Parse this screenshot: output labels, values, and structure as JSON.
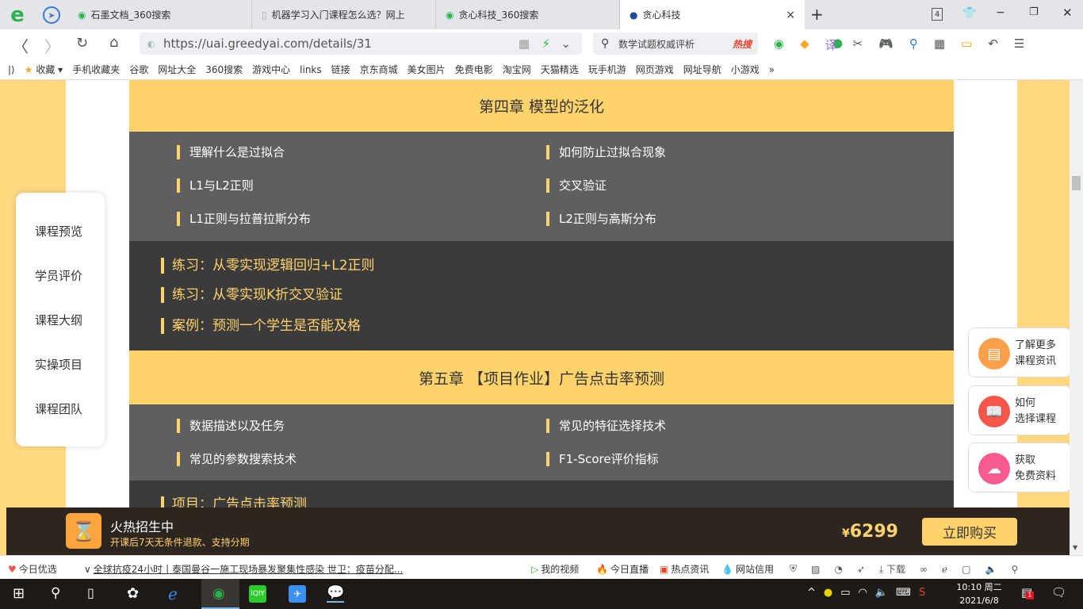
{
  "browser": {
    "tabs": [
      {
        "label": "石墨文档_360搜索",
        "active": false
      },
      {
        "label": "机器学习入门课程怎么选？网上",
        "active": false
      },
      {
        "label": "贪心科技_360搜索",
        "active": false
      },
      {
        "label": "贪心科技",
        "active": true
      }
    ],
    "tab_count": "4",
    "url": "https://uai.greedyai.com/details/31",
    "search_placeholder": "数学试题权威评析",
    "hot_search": "热搜",
    "bookmarks": [
      "收藏",
      "手机收藏夹",
      "谷歌",
      "网址大全",
      "360搜索",
      "游戏中心",
      "links",
      "链接",
      "京东商城",
      "美女图片",
      "免费电影",
      "淘宝网",
      "天猫精选",
      "玩手机游",
      "网页游戏",
      "网址导航",
      "小游戏",
      "»"
    ]
  },
  "side_nav": [
    "课程预览",
    "学员评价",
    "课程大纲",
    "实操项目",
    "课程团队"
  ],
  "chapters": [
    {
      "title": "第四章 模型的泛化",
      "topics": [
        "理解什么是过拟合",
        "如何防止过拟合现象",
        "L1与L2正则",
        "交叉验证",
        "L1正则与拉普拉斯分布",
        "L2正则与高斯分布"
      ],
      "exercises": [
        "练习：从零实现逻辑回归+L2正则",
        "练习：从零实现K折交叉验证",
        "案例：预测一个学生是否能及格"
      ]
    },
    {
      "title": "第五章 【项目作业】广告点击率预测",
      "topics": [
        "数据描述以及任务",
        "常见的特征选择技术",
        "常见的参数搜索技术",
        "F1-Score评价指标"
      ],
      "exercises": [
        "项目：广告点击率预测"
      ]
    }
  ],
  "right_cards": [
    {
      "line1": "了解更多",
      "line2": "课程资讯",
      "color": "#fba04a"
    },
    {
      "line1": "如何",
      "line2": "选择课程",
      "color": "#f5564a"
    },
    {
      "line1": "获取",
      "line2": "免费资料",
      "color": "#f85a92"
    }
  ],
  "bottom_bar": {
    "title": "火热招生中",
    "subtitle": "开课后7天无条件退款、支持分期",
    "currency": "¥",
    "price": "6299",
    "buy_label": "立即购买"
  },
  "status_bar": {
    "today": "今日优选",
    "news": "全球抗疫24小时丨泰国曼谷一施工现场暴发聚集性感染 世卫：疫苗分配...",
    "links": [
      "我的视频",
      "今日直播",
      "热点资讯",
      "网站信用"
    ],
    "download": "下载"
  },
  "taskbar": {
    "time": "10:10 周二",
    "date": "2021/6/8",
    "notif": "1"
  },
  "colors": {
    "accent": "#ffd36b",
    "gray_row": "#5f5f5f",
    "dark_row": "#3b3b3b"
  }
}
